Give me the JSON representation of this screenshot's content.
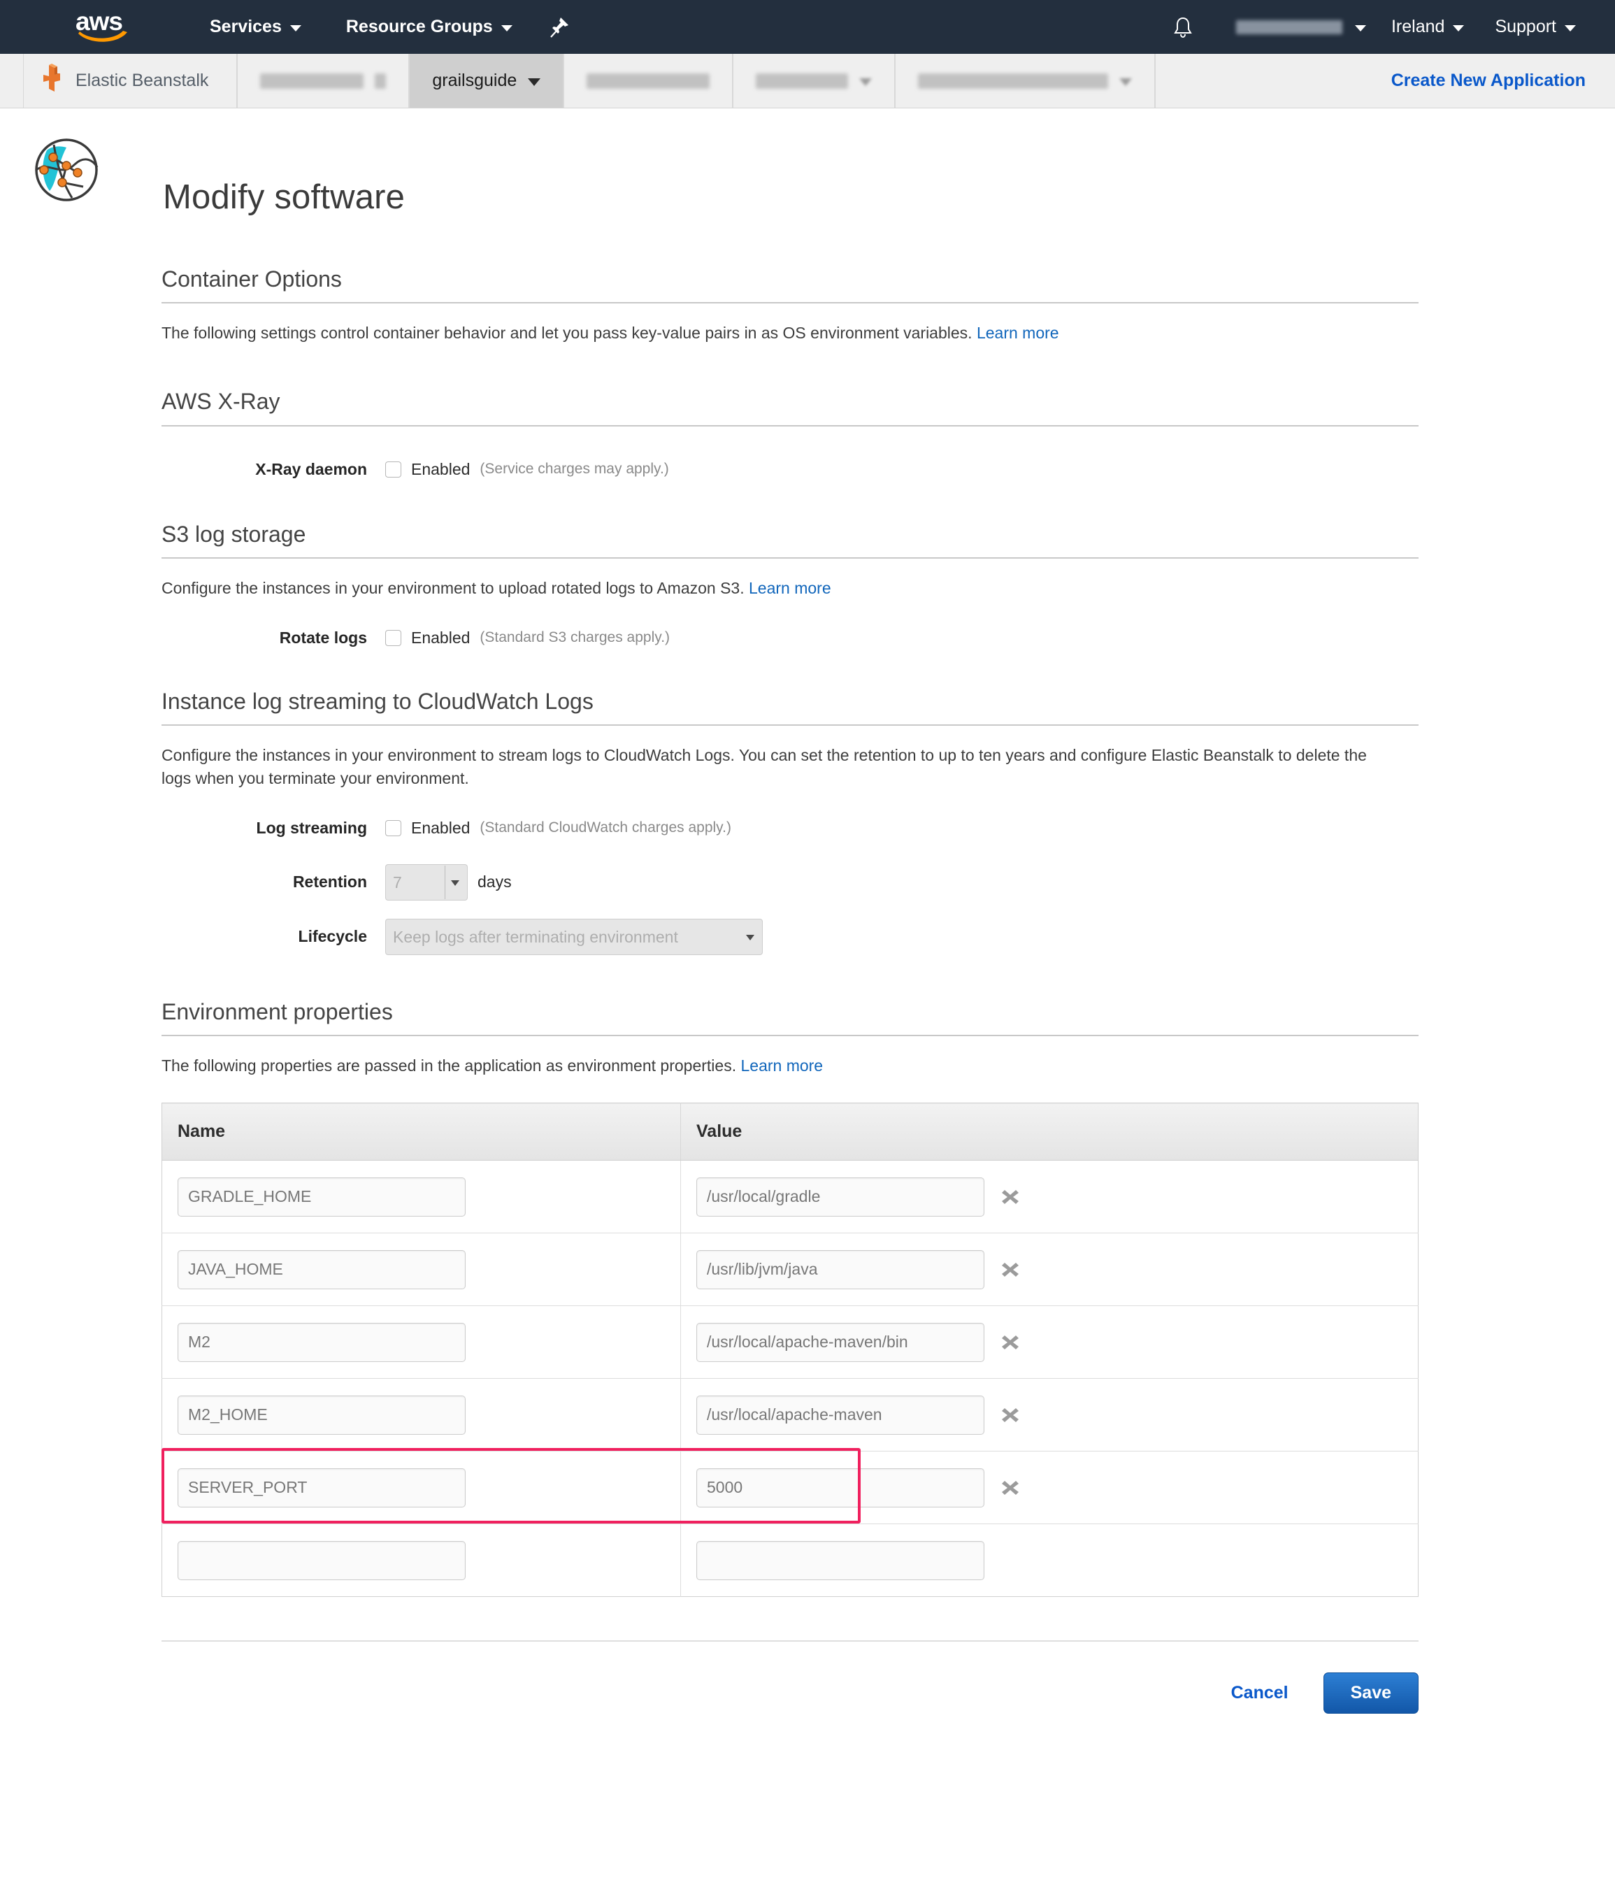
{
  "topnav": {
    "logo_text": "aws",
    "services_label": "Services",
    "resource_groups_label": "Resource Groups",
    "pin_icon": "pushpin-icon",
    "bell_icon": "bell-icon",
    "account_label": "",
    "region_label": "Ireland",
    "support_label": "Support"
  },
  "breadcrumb": {
    "service_label": "Elastic Beanstalk",
    "application_label": "",
    "environment_label": "grailsguide",
    "crumb4_label": "",
    "crumb5_label": "",
    "create_app_label": "Create New Application"
  },
  "page": {
    "title": "Modify software",
    "icon": "environment-globe-icon"
  },
  "sections": {
    "container_options": {
      "heading": "Container Options",
      "description": "The following settings control container behavior and let you pass key-value pairs in as OS environment variables.",
      "learn_more": "Learn more"
    },
    "xray": {
      "heading": "AWS X-Ray",
      "field_label": "X-Ray daemon",
      "checkbox_label": "Enabled",
      "checkbox_note": "(Service charges may apply.)",
      "checked": false
    },
    "s3_log_storage": {
      "heading": "S3 log storage",
      "description": "Configure the instances in your environment to upload rotated logs to Amazon S3.",
      "learn_more": "Learn more",
      "field_label": "Rotate logs",
      "checkbox_label": "Enabled",
      "checkbox_note": "(Standard S3 charges apply.)",
      "checked": false
    },
    "cloudwatch": {
      "heading": "Instance log streaming to CloudWatch Logs",
      "description": "Configure the instances in your environment to stream logs to CloudWatch Logs. You can set the retention to up to ten years and configure Elastic Beanstalk to delete the logs when you terminate your environment.",
      "log_streaming_label": "Log streaming",
      "checkbox_label": "Enabled",
      "checkbox_note": "(Standard CloudWatch charges apply.)",
      "checked": false,
      "retention_label": "Retention",
      "retention_value": "7",
      "retention_unit": "days",
      "lifecycle_label": "Lifecycle",
      "lifecycle_value": "Keep logs after terminating environment"
    },
    "environment_properties": {
      "heading": "Environment properties",
      "description": "The following properties are passed in the application as environment properties.",
      "learn_more": "Learn more",
      "columns": [
        "Name",
        "Value"
      ],
      "highlight_color": "#f0205e",
      "rows": [
        {
          "name": "GRADLE_HOME",
          "value": "/usr/local/gradle",
          "has_delete": true,
          "highlighted": false
        },
        {
          "name": "JAVA_HOME",
          "value": "/usr/lib/jvm/java",
          "has_delete": true,
          "highlighted": false
        },
        {
          "name": "M2",
          "value": "/usr/local/apache-maven/bin",
          "has_delete": true,
          "highlighted": false
        },
        {
          "name": "M2_HOME",
          "value": "/usr/local/apache-maven",
          "has_delete": true,
          "highlighted": false
        },
        {
          "name": "SERVER_PORT",
          "value": "5000",
          "has_delete": true,
          "highlighted": true
        },
        {
          "name": "",
          "value": "",
          "has_delete": false,
          "highlighted": false
        }
      ]
    }
  },
  "footer": {
    "cancel_label": "Cancel",
    "save_label": "Save"
  }
}
